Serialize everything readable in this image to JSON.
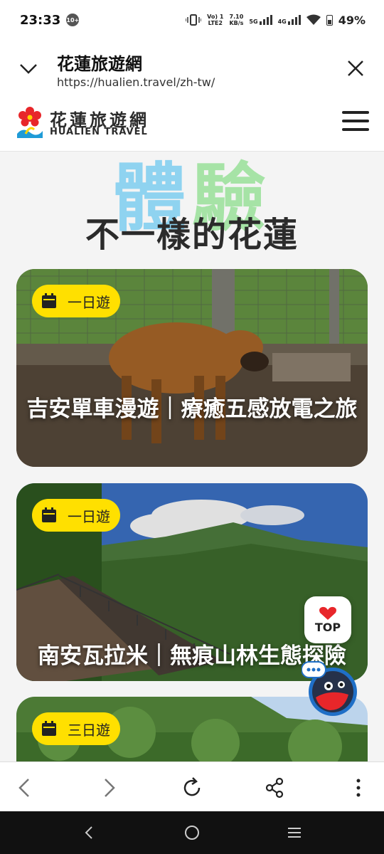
{
  "status": {
    "time": "23:33",
    "notif_badge": "10+",
    "volte": "Vo) 1",
    "lte": "LTE2",
    "speed": "7.10",
    "speed_unit": "KB/s",
    "net1": "5G",
    "net2": "4G",
    "battery": "49%"
  },
  "browser": {
    "title": "花蓮旅遊網",
    "url": "https://hualien.travel/zh-tw/"
  },
  "site": {
    "logo_cn": "花蓮旅遊網",
    "logo_en": "HUALIEN TRAVEL"
  },
  "hero": {
    "bg_char_1": "體",
    "bg_char_2": "驗",
    "headline": "不一樣的花蓮"
  },
  "cards": [
    {
      "tag": "一日遊",
      "title": "吉安單車漫遊｜療癒五感放電之旅"
    },
    {
      "tag": "一日遊",
      "title": "南安瓦拉米｜無痕山林生態探險"
    },
    {
      "tag": "三日遊",
      "title": ""
    }
  ],
  "float": {
    "top_label": "TOP"
  },
  "colors": {
    "tag_yellow": "#ffe000",
    "accent_red": "#e8262a",
    "bg_blue": "#8fd3f0",
    "bg_green": "#a6e3a6"
  }
}
